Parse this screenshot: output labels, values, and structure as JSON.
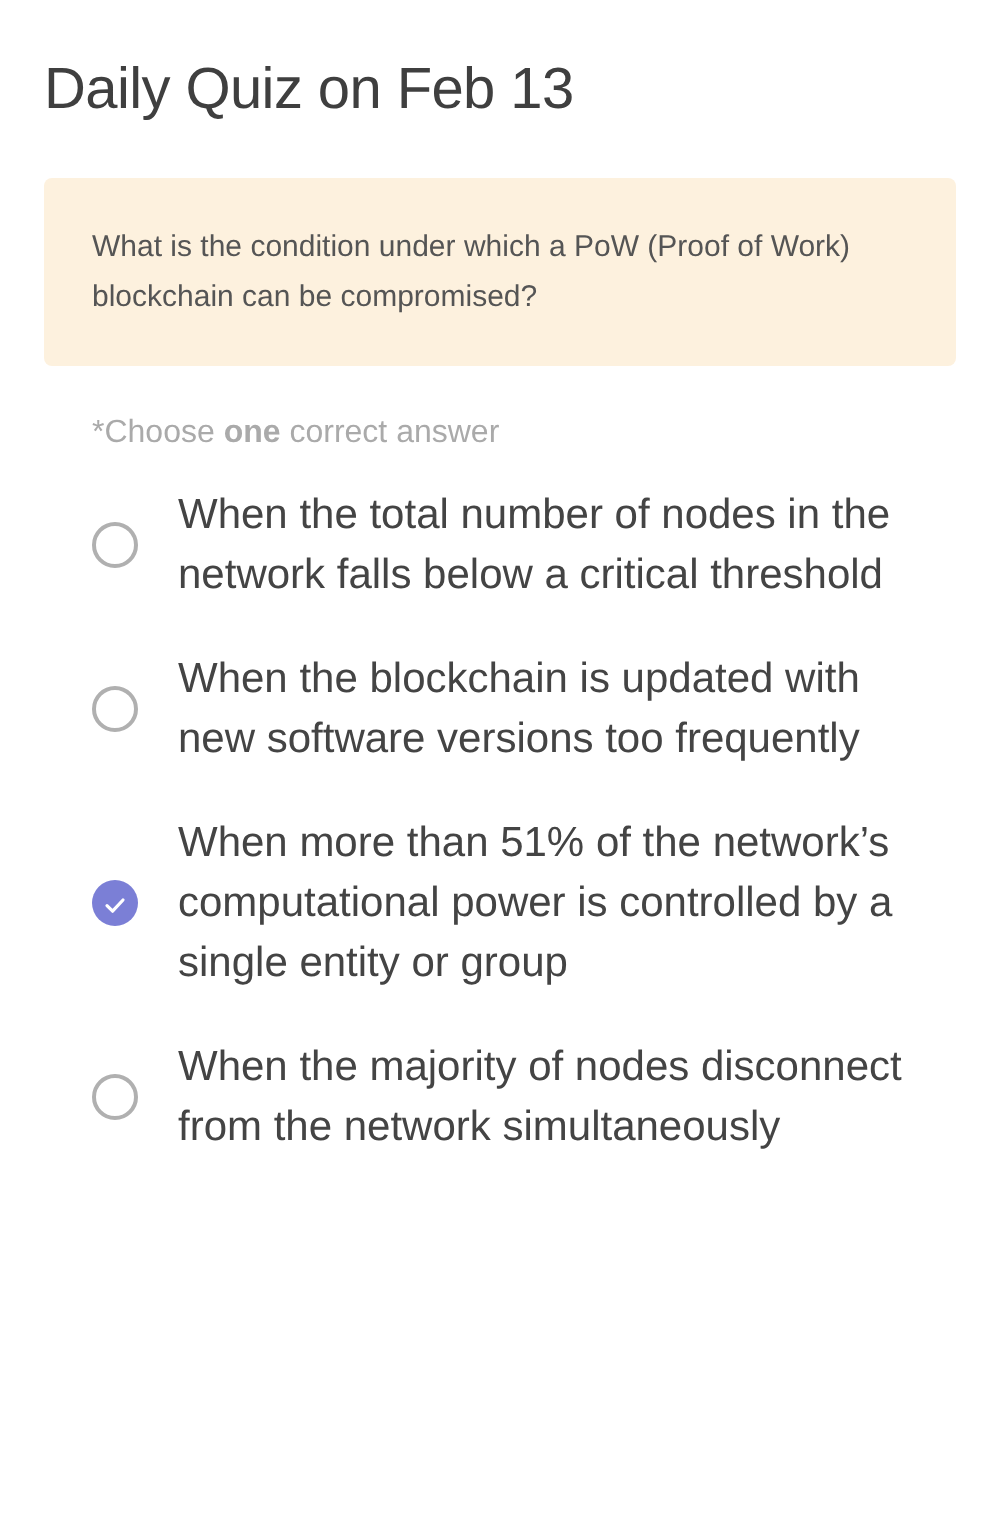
{
  "title": "Daily Quiz on Feb 13",
  "question": "What is the condition under which a PoW (Proof of Work) blockchain can be compromised?",
  "hint": "*Choose **one** correct answer",
  "options": [
    {
      "text": "When the total number of nodes in the network falls below a critical threshold",
      "selected": false
    },
    {
      "text": "When the blockchain is updated with new software versions too frequently",
      "selected": false
    },
    {
      "text": "When more than 51% of the network’s computational power is controlled by a single entity or group",
      "selected": true
    },
    {
      "text": "When the majority of nodes disconnect from the network simultaneously",
      "selected": false
    }
  ]
}
